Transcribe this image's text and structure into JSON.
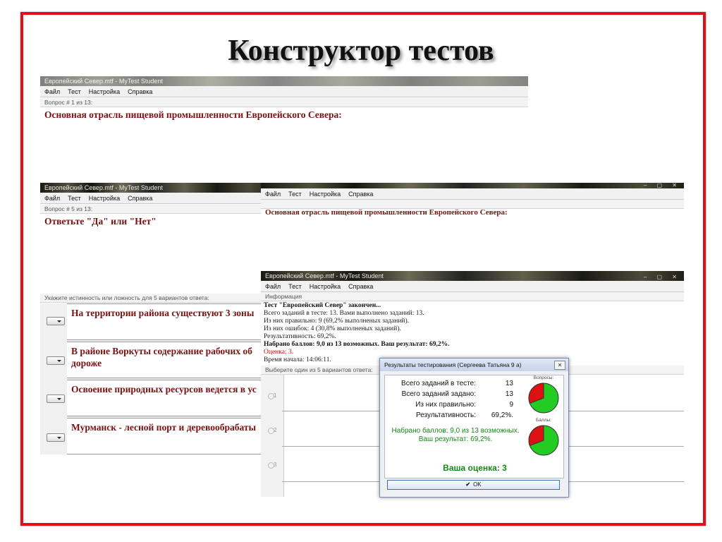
{
  "slide": {
    "title": "Конструктор тестов"
  },
  "window1": {
    "title": "Европейский Север.mtf - MyTest Student",
    "menu": [
      "Файл",
      "Тест",
      "Настройка",
      "Справка"
    ],
    "status": "Вопрос # 1 из 13:",
    "question": "Основная отрасль пищевой промышленности Европейского Севера:"
  },
  "window2": {
    "title": "Европейский Север.mtf - MyTest Student",
    "menu": [
      "Файл",
      "Тест",
      "Настройка",
      "Справка"
    ],
    "status": "Вопрос # 5 из 13:",
    "question": "Ответьте \"Да\" или \"Нет\"",
    "instruction": "Укажите истинность или ложность для 5 вариантов ответа:",
    "answers": [
      [
        "На территории района существуют 3 зоны"
      ],
      [
        "В районе Воркуты содержание рабочих об",
        "дороже"
      ],
      [
        "Освоение природных ресурсов ведется в ус"
      ],
      [
        "Мурманск - лесной порт и деревообрабаты"
      ]
    ]
  },
  "window3": {
    "menu": [
      "Файл",
      "Тест",
      "Настройка",
      "Справка"
    ],
    "question": "Основная отрасль пищевой промышленности Европейского Севера:"
  },
  "window4": {
    "title": "Европейский Север.mtf - MyTest Student",
    "menu": [
      "Файл",
      "Тест",
      "Настройка",
      "Справка"
    ],
    "status": "Информация",
    "info_lines": [
      "Тест \"Европейский Север\" закончен...",
      "Всего заданий в тесте: 13. Вами выполнено заданий: 13.",
      "Из них правильно: 9 (69,2% выполненых заданий).",
      "Из них ошибок: 4 (30,8% выполненых заданий).",
      "Результативность: 69,2%.",
      "Набрано баллов: 9,0 из 13 возможных. Ваш результат: 69,2%.",
      "Оценка: 3.",
      "Время начала: 14:06:11."
    ],
    "choose_line": "Выберите один из 5 вариантов ответа:",
    "option_numbers": [
      "1",
      "2",
      "3"
    ]
  },
  "dialog": {
    "title": "Результаты тестирования (Сергеева Татьяна 9 а)",
    "close": "✕",
    "stats": [
      {
        "label": "Всего заданий в тесте:",
        "value": "13"
      },
      {
        "label": "Всего заданий задано:",
        "value": "13"
      },
      {
        "label": "Из них правильно:",
        "value": "9"
      },
      {
        "label": "Результативность:",
        "value": "69,2%."
      }
    ],
    "score_line1": "Набрано баллов: 9,0 из 13 возможных.",
    "score_line2": "Ваш результат: 69,2%.",
    "grade": "Ваша оценка: 3",
    "pie1_label": "Вопросы:",
    "pie2_label": "Баллы:",
    "pie1_correct_fraction": 0.692,
    "pie2_correct_fraction": 0.692,
    "pie_colors": {
      "correct": "#22cc22",
      "wrong": "#dd1111"
    },
    "ok_label": "OK"
  }
}
